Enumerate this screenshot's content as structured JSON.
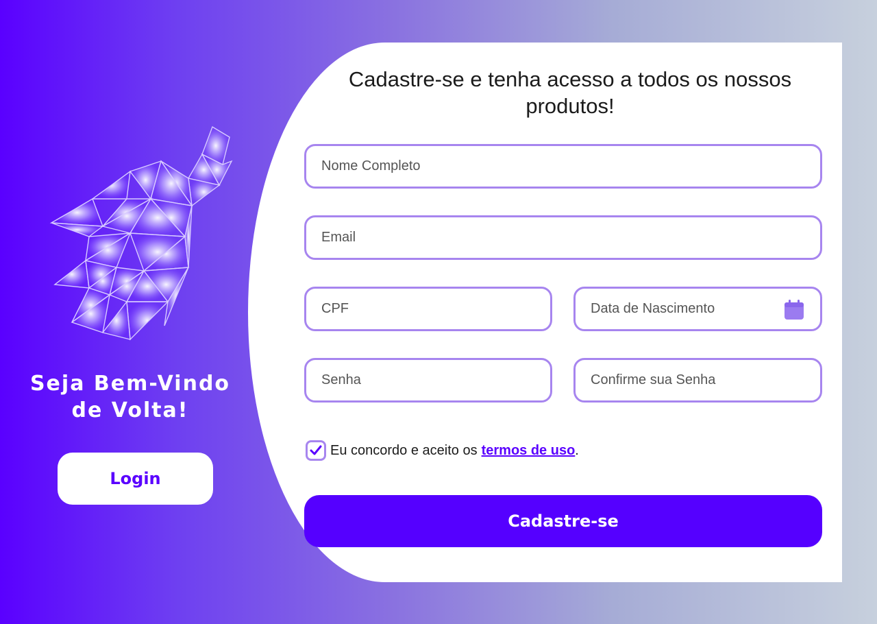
{
  "left_panel": {
    "welcome_line1": "Seja Bem-Vindo",
    "welcome_line2": "de Volta!",
    "login_label": "Login",
    "logo_icon": "wolf-howling-polygon-logo"
  },
  "form": {
    "title_line1": "Cadastre-se e tenha acesso a todos os nossos",
    "title_line2": "produtos!",
    "fields": {
      "full_name": {
        "placeholder": "Nome Completo",
        "value": ""
      },
      "email": {
        "placeholder": "Email",
        "value": ""
      },
      "cpf": {
        "placeholder": "CPF",
        "value": ""
      },
      "birth_date": {
        "placeholder": "Data de Nascimento",
        "value": "",
        "icon": "calendar-icon"
      },
      "password": {
        "placeholder": "Senha",
        "value": ""
      },
      "confirm_password": {
        "placeholder": "Confirme sua Senha",
        "value": ""
      }
    },
    "terms": {
      "checked": true,
      "text": "Eu concordo e aceito os",
      "link": "termos de uso",
      "suffix": "."
    },
    "submit_label": "Cadastre-se"
  },
  "colors": {
    "accent": "#5500ff",
    "field_border": "#a785ef"
  }
}
